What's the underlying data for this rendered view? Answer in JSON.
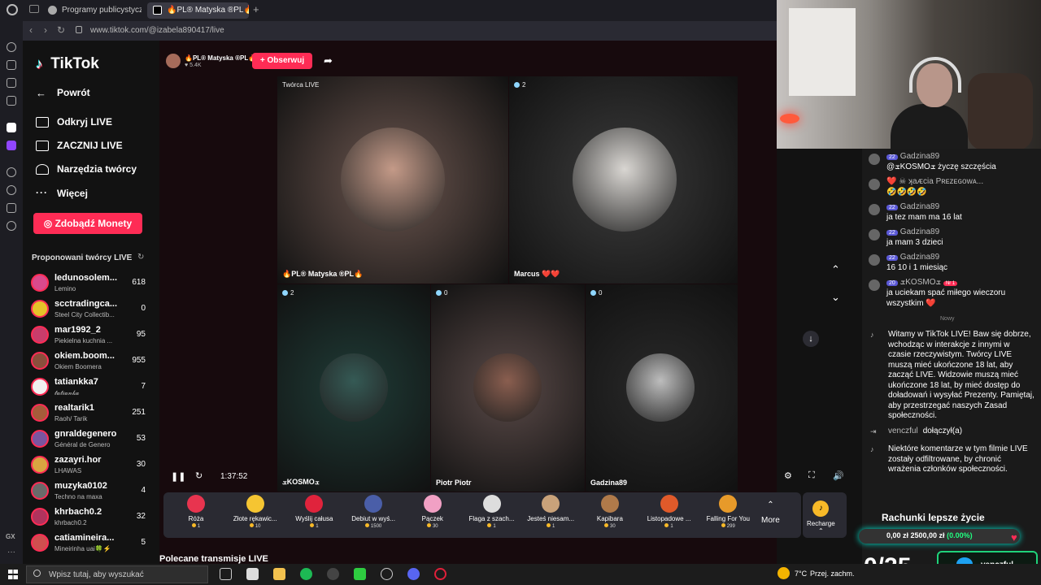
{
  "browser": {
    "tabs": [
      {
        "label": "Programy publicystyczne"
      },
      {
        "label": "🔥PL® Matyska ®PL🔥"
      }
    ],
    "url": "www.tiktok.com/@izabela890417/live"
  },
  "sidebar": {
    "logo": "TikTok",
    "nav": [
      {
        "label": "Powrót",
        "icon": "back-arrow-icon"
      },
      {
        "label": "Odkryj LIVE",
        "icon": "calendar-live-icon"
      },
      {
        "label": "ZACZNIJ LIVE",
        "icon": "camera-icon"
      },
      {
        "label": "Narzędzia twórcy",
        "icon": "tools-icon"
      },
      {
        "label": "Więcej",
        "icon": "more-icon"
      }
    ],
    "coins_button": "Zdobądź Monety",
    "suggested_title": "Proponowani twórcy LIVE",
    "creators": [
      {
        "name": "ledunosolem...",
        "sub": "Lemino",
        "count": "618"
      },
      {
        "name": "scctradingca...",
        "sub": "Steel City Collectib...",
        "count": "0"
      },
      {
        "name": "mar1992_2",
        "sub": "Piekielna kuchnia ...",
        "count": "95"
      },
      {
        "name": "okiem.boom...",
        "sub": "Okiem Boomera",
        "count": "955"
      },
      {
        "name": "tatiankka7",
        "sub": "𝓉𝒶𝓉𝒾𝒶𝓃𝓀𝒶",
        "count": "7"
      },
      {
        "name": "realtarik1",
        "sub": "Raoh/ Tarik",
        "count": "251"
      },
      {
        "name": "gnraldegenero",
        "sub": "Général de Genero",
        "count": "53"
      },
      {
        "name": "zazayri.hor",
        "sub": "LHAWAS",
        "count": "30"
      },
      {
        "name": "muzyka0102",
        "sub": "Techno na maxa",
        "count": "4"
      },
      {
        "name": "khrbach0.2",
        "sub": "khrbach0.2",
        "count": "32"
      },
      {
        "name": "catiamineira...",
        "sub": "Mineirinha uai🍀⚡",
        "count": "5"
      }
    ]
  },
  "live": {
    "host_name": "🔥PL® Matyska ®PL🔥",
    "host_likes": "♥ 5.4K",
    "follow_label": "+ Obserwuj",
    "cells": [
      {
        "top": "Twórca LIVE",
        "bottom": "🔥PL® Matyska ®PL🔥",
        "bg": "#6d5750",
        "circle": "#c49a88"
      },
      {
        "top": "2",
        "bottom": "Marcus ❤️❤️",
        "bg": "#3c3c3c",
        "circle": "#d9d6d2"
      },
      {
        "top": "2",
        "bottom": "ܫKOSMOܫ",
        "bg": "#1f3b36",
        "circle": "#355a55"
      },
      {
        "top": "0",
        "bottom": "Piotr Piotr",
        "bg": "#5a4a48",
        "circle": "#8a5e4f"
      },
      {
        "top": "0",
        "bottom": "Gadzina89",
        "bg": "#2a2a2a",
        "circle": "#bdbdbd"
      }
    ],
    "time": "1:37:52",
    "gifts": [
      {
        "name": "Róża",
        "price": "1",
        "color": "#e8344f"
      },
      {
        "name": "Złote rękawic...",
        "price": "10",
        "color": "#f5c532"
      },
      {
        "name": "Wyślij całusa",
        "price": "1",
        "color": "#e0233c"
      },
      {
        "name": "Debiut w wyś...",
        "price": "1500",
        "color": "#4a5ea8"
      },
      {
        "name": "Pączek",
        "price": "30",
        "color": "#f1a0c4"
      },
      {
        "name": "Flaga z szach...",
        "price": "1",
        "color": "#dddddd"
      },
      {
        "name": "Jesteś niesam...",
        "price": "1",
        "color": "#c9a27a"
      },
      {
        "name": "Kapibara",
        "price": "30",
        "color": "#b07a4a"
      },
      {
        "name": "Listopadowe ...",
        "price": "1",
        "color": "#e05a2a"
      },
      {
        "name": "Falling For You",
        "price": "299",
        "color": "#e79a2a"
      }
    ],
    "more_label": "More",
    "recharge_label": "Recharge ⌃",
    "recommended_title": "Polecane transmisje LIVE"
  },
  "chat": {
    "messages": [
      {
        "level": "22",
        "user": "Gadzina89",
        "text": "@ܫKOSMOܫ życzę szczęścia"
      },
      {
        "level": "",
        "user": "❤️ ☠ ʞaᴁcia Pʀᴇᴢᴇɢᴏᴡᴀ...",
        "text": "🤣🤣🤣🤣"
      },
      {
        "level": "22",
        "user": "Gadzina89",
        "text": "ja tez mam ma 16 lat"
      },
      {
        "level": "22",
        "user": "Gadzina89",
        "text": "ja mam 3 dzieci"
      },
      {
        "level": "22",
        "user": "Gadzina89",
        "text": "16 10 i 1 miesiąc"
      },
      {
        "level": "20",
        "user": "ܫKOSMOܫ",
        "rank": "Nr 1",
        "text": "ja uciekam spać miłego wieczoru wszystkim ❤️"
      }
    ],
    "new_label": "Nowy",
    "welcome": "Witamy w TikTok LIVE! Baw się dobrze, wchodząc w interakcje z innymi w czasie rzeczywistym. Twórcy LIVE muszą mieć ukończone 18 lat, aby zacząć LIVE. Widzowie muszą mieć ukończone 18 lat, by mieć dostęp do doładowań i wysyłać Prezenty. Pamiętaj, aby przestrzegać naszych Zasad społeczności.",
    "join_user": "venczful",
    "join_text": "dołączył(a)",
    "filter_note": "Niektóre komentarze w tym filmie LIVE zostały odfiltrowane, by chronić wrażenia członków społeczności."
  },
  "overlay": {
    "goal_title": "Rachunki lepsze życie",
    "goal_value": "0,00 zł   2500,00 zł",
    "goal_percent": "(0.00%)",
    "goal_fraction": 0,
    "counter": "0/25",
    "twitter_name": "venczful"
  },
  "taskbar": {
    "search_placeholder": "Wpisz tutaj, aby wyszukać",
    "temperature": "7°C",
    "weather": "Przej. zachm."
  }
}
